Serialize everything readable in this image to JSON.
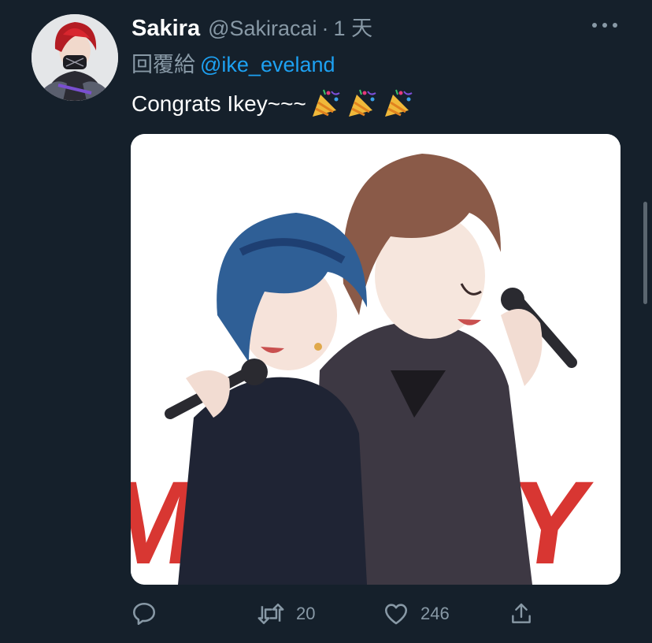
{
  "tweet": {
    "display_name": "Sakira",
    "handle": "@Sakiracai",
    "separator": "·",
    "timestamp": "1 天",
    "reply_prefix": "回覆給",
    "reply_to": "@ike_eveland",
    "text": "Congrats Ikey~~~",
    "emoji": [
      "party-popper",
      "party-popper",
      "party-popper"
    ],
    "media_watermark": "MAYDAY"
  },
  "actions": {
    "reply_count": "",
    "retweet_count": "20",
    "like_count": "246"
  },
  "colors": {
    "background": "#15202b",
    "secondary_text": "#8899a6",
    "link": "#1da1f2",
    "primary_text": "#ffffff"
  },
  "icons": {
    "more": "more-horizontal-icon",
    "reply": "reply-icon",
    "retweet": "retweet-icon",
    "like": "heart-icon",
    "share": "share-icon"
  }
}
